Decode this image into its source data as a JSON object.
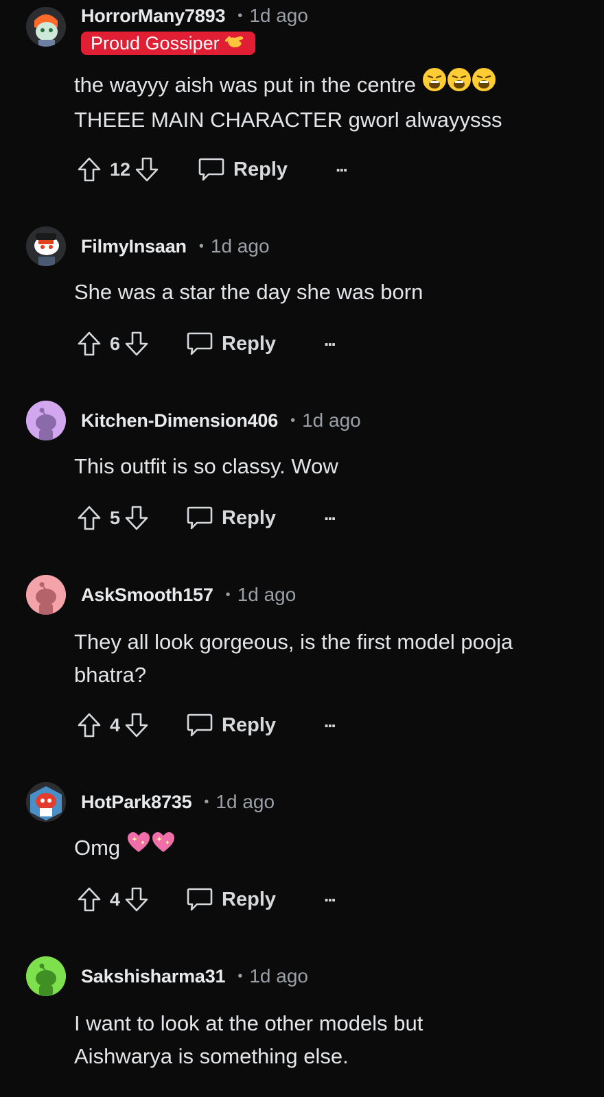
{
  "comments": [
    {
      "username": "HorrorMany7893",
      "time": "1d ago",
      "flair": "Proud Gossiper",
      "flair_color": "#e01e34",
      "text_lines": [
        "the wayyy aish was put in the centre",
        "THEEE MAIN CHARACTER gworl alwayysss"
      ],
      "votes": "12",
      "reply_label": "Reply",
      "more_label": "...",
      "avatar_color": "#ff6a2a"
    },
    {
      "username": "FilmyInsaan",
      "time": "1d ago",
      "text_lines": [
        "She was a star the day she was born"
      ],
      "votes": "6",
      "reply_label": "Reply",
      "more_label": "...",
      "avatar_color": "#ffffff"
    },
    {
      "username": "Kitchen-Dimension406",
      "time": "1d ago",
      "text_lines": [
        "This outfit is so classy. Wow"
      ],
      "votes": "5",
      "reply_label": "Reply",
      "more_label": "...",
      "avatar_color": "#d2a7f0"
    },
    {
      "username": "AskSmooth157",
      "time": "1d ago",
      "text_lines": [
        "They all look gorgeous, is the first model pooja",
        "bhatra?"
      ],
      "votes": "4",
      "reply_label": "Reply",
      "more_label": "...",
      "avatar_color": "#f4a3a8"
    },
    {
      "username": "HotPark8735",
      "time": "1d ago",
      "text_lines": [
        "Omg"
      ],
      "votes": "4",
      "reply_label": "Reply",
      "more_label": "...",
      "avatar_color": "#e23c2c"
    },
    {
      "username": "Sakshisharma31",
      "time": "1d ago",
      "text_lines": [
        "I want to look at the other models but",
        "Aishwarya is something else."
      ],
      "avatar_color": "#7ee04d"
    }
  ],
  "dot_separator": "•",
  "icons": {
    "upvote": "upvote-arrow-icon",
    "downvote": "downvote-arrow-icon",
    "reply": "speech-bubble-icon",
    "more": "overflow-dots-icon",
    "weary_emoji": "weary-face-emoji",
    "sparkle_heart": "sparkling-heart-emoji",
    "flair_hand": "call-me-hand-emoji"
  }
}
